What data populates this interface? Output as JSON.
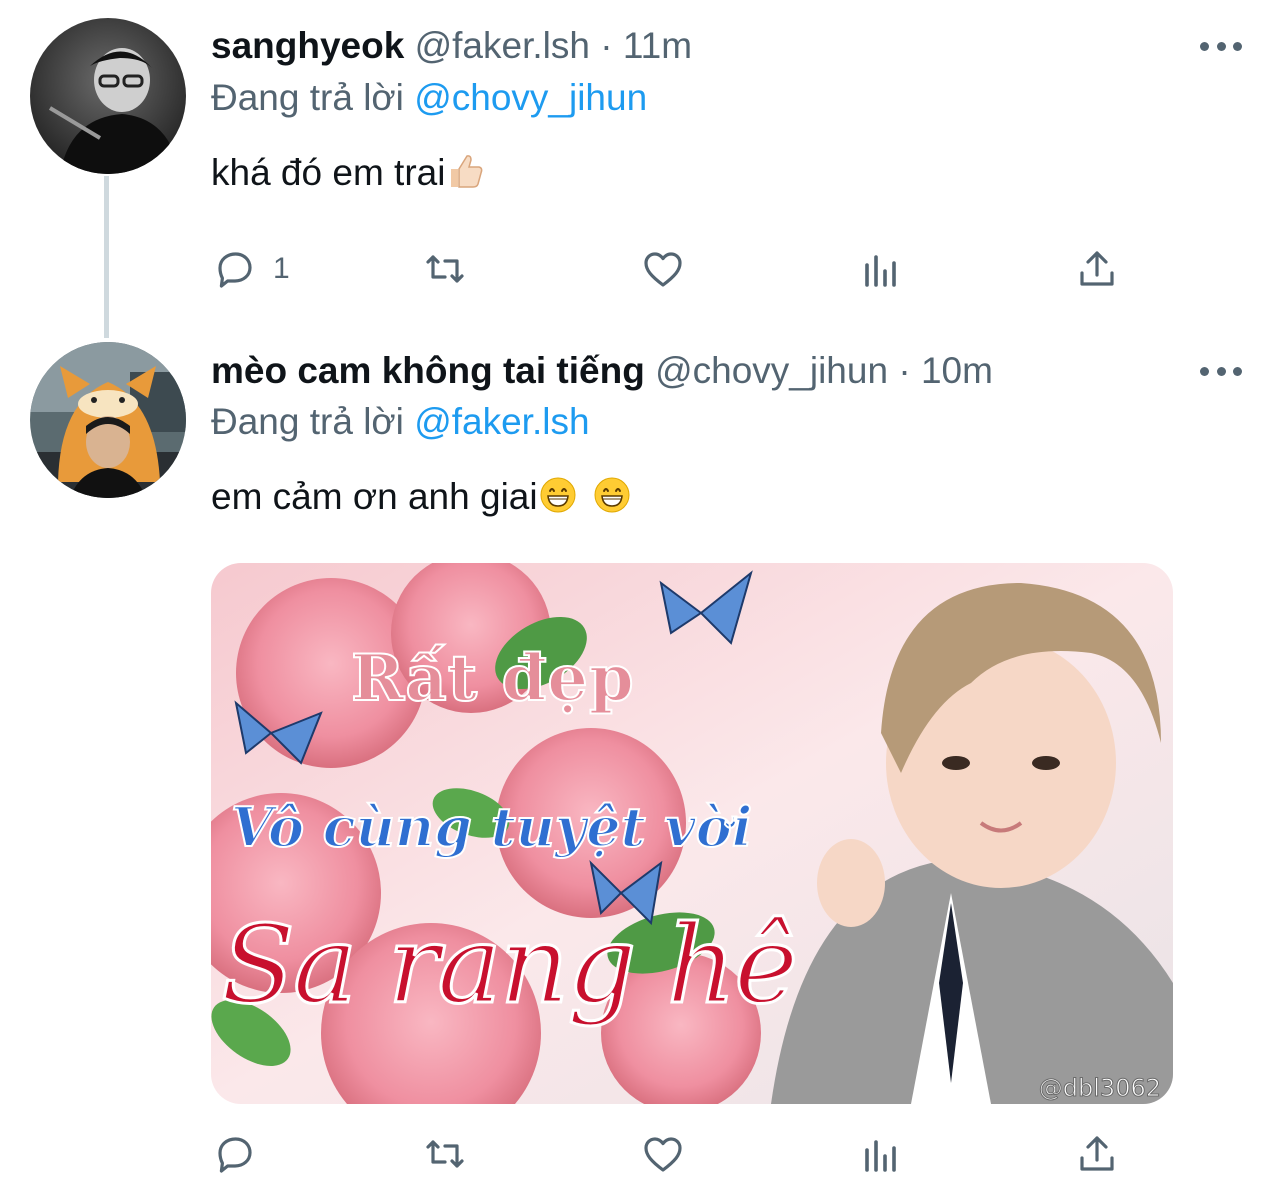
{
  "tweets": [
    {
      "display_name": "sanghyeok",
      "handle": "@faker.lsh",
      "separator": "·",
      "time": "11m",
      "replying_label": "Đang trả lời",
      "replying_to": "@chovy_jihun",
      "text": "khá đó em trai",
      "emoji": "thumbs-up",
      "reply_count": "1",
      "avatar_icon": "grayscale-portrait"
    },
    {
      "display_name": "mèo cam không tai tiếng",
      "handle": "@chovy_jihun",
      "separator": "·",
      "time": "10m",
      "replying_label": "Đang trả lời",
      "replying_to": "@faker.lsh",
      "text": "em cảm ơn anh giai",
      "emoji": "grinning-face x2",
      "reply_count": "",
      "avatar_icon": "orange-cat-hood-portrait",
      "media": {
        "line1": "Rất đẹp",
        "line2": "Vô cùng tuyệt vời",
        "line3": "Sa rang hê",
        "watermark": "@dbl3062"
      }
    }
  ],
  "colors": {
    "accent": "#1d9bf0",
    "secondary_text": "#536471",
    "primary_text": "#0f1419",
    "thread_line": "#cfd9de"
  }
}
